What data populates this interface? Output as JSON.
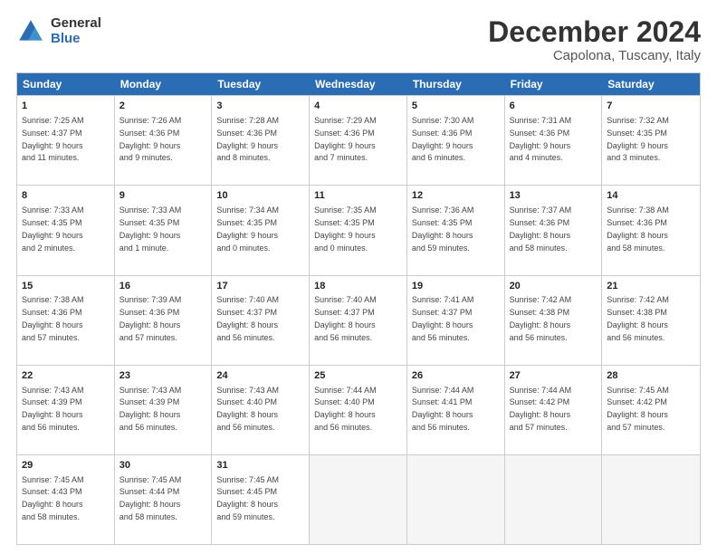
{
  "logo": {
    "general": "General",
    "blue": "Blue"
  },
  "title": "December 2024",
  "location": "Capolona, Tuscany, Italy",
  "header_days": [
    "Sunday",
    "Monday",
    "Tuesday",
    "Wednesday",
    "Thursday",
    "Friday",
    "Saturday"
  ],
  "weeks": [
    [
      {
        "day": "1",
        "info": "Sunrise: 7:25 AM\nSunset: 4:37 PM\nDaylight: 9 hours\nand 11 minutes."
      },
      {
        "day": "2",
        "info": "Sunrise: 7:26 AM\nSunset: 4:36 PM\nDaylight: 9 hours\nand 9 minutes."
      },
      {
        "day": "3",
        "info": "Sunrise: 7:28 AM\nSunset: 4:36 PM\nDaylight: 9 hours\nand 8 minutes."
      },
      {
        "day": "4",
        "info": "Sunrise: 7:29 AM\nSunset: 4:36 PM\nDaylight: 9 hours\nand 7 minutes."
      },
      {
        "day": "5",
        "info": "Sunrise: 7:30 AM\nSunset: 4:36 PM\nDaylight: 9 hours\nand 6 minutes."
      },
      {
        "day": "6",
        "info": "Sunrise: 7:31 AM\nSunset: 4:36 PM\nDaylight: 9 hours\nand 4 minutes."
      },
      {
        "day": "7",
        "info": "Sunrise: 7:32 AM\nSunset: 4:35 PM\nDaylight: 9 hours\nand 3 minutes."
      }
    ],
    [
      {
        "day": "8",
        "info": "Sunrise: 7:33 AM\nSunset: 4:35 PM\nDaylight: 9 hours\nand 2 minutes."
      },
      {
        "day": "9",
        "info": "Sunrise: 7:33 AM\nSunset: 4:35 PM\nDaylight: 9 hours\nand 1 minute."
      },
      {
        "day": "10",
        "info": "Sunrise: 7:34 AM\nSunset: 4:35 PM\nDaylight: 9 hours\nand 0 minutes."
      },
      {
        "day": "11",
        "info": "Sunrise: 7:35 AM\nSunset: 4:35 PM\nDaylight: 9 hours\nand 0 minutes."
      },
      {
        "day": "12",
        "info": "Sunrise: 7:36 AM\nSunset: 4:35 PM\nDaylight: 8 hours\nand 59 minutes."
      },
      {
        "day": "13",
        "info": "Sunrise: 7:37 AM\nSunset: 4:36 PM\nDaylight: 8 hours\nand 58 minutes."
      },
      {
        "day": "14",
        "info": "Sunrise: 7:38 AM\nSunset: 4:36 PM\nDaylight: 8 hours\nand 58 minutes."
      }
    ],
    [
      {
        "day": "15",
        "info": "Sunrise: 7:38 AM\nSunset: 4:36 PM\nDaylight: 8 hours\nand 57 minutes."
      },
      {
        "day": "16",
        "info": "Sunrise: 7:39 AM\nSunset: 4:36 PM\nDaylight: 8 hours\nand 57 minutes."
      },
      {
        "day": "17",
        "info": "Sunrise: 7:40 AM\nSunset: 4:37 PM\nDaylight: 8 hours\nand 56 minutes."
      },
      {
        "day": "18",
        "info": "Sunrise: 7:40 AM\nSunset: 4:37 PM\nDaylight: 8 hours\nand 56 minutes."
      },
      {
        "day": "19",
        "info": "Sunrise: 7:41 AM\nSunset: 4:37 PM\nDaylight: 8 hours\nand 56 minutes."
      },
      {
        "day": "20",
        "info": "Sunrise: 7:42 AM\nSunset: 4:38 PM\nDaylight: 8 hours\nand 56 minutes."
      },
      {
        "day": "21",
        "info": "Sunrise: 7:42 AM\nSunset: 4:38 PM\nDaylight: 8 hours\nand 56 minutes."
      }
    ],
    [
      {
        "day": "22",
        "info": "Sunrise: 7:43 AM\nSunset: 4:39 PM\nDaylight: 8 hours\nand 56 minutes."
      },
      {
        "day": "23",
        "info": "Sunrise: 7:43 AM\nSunset: 4:39 PM\nDaylight: 8 hours\nand 56 minutes."
      },
      {
        "day": "24",
        "info": "Sunrise: 7:43 AM\nSunset: 4:40 PM\nDaylight: 8 hours\nand 56 minutes."
      },
      {
        "day": "25",
        "info": "Sunrise: 7:44 AM\nSunset: 4:40 PM\nDaylight: 8 hours\nand 56 minutes."
      },
      {
        "day": "26",
        "info": "Sunrise: 7:44 AM\nSunset: 4:41 PM\nDaylight: 8 hours\nand 56 minutes."
      },
      {
        "day": "27",
        "info": "Sunrise: 7:44 AM\nSunset: 4:42 PM\nDaylight: 8 hours\nand 57 minutes."
      },
      {
        "day": "28",
        "info": "Sunrise: 7:45 AM\nSunset: 4:42 PM\nDaylight: 8 hours\nand 57 minutes."
      }
    ],
    [
      {
        "day": "29",
        "info": "Sunrise: 7:45 AM\nSunset: 4:43 PM\nDaylight: 8 hours\nand 58 minutes."
      },
      {
        "day": "30",
        "info": "Sunrise: 7:45 AM\nSunset: 4:44 PM\nDaylight: 8 hours\nand 58 minutes."
      },
      {
        "day": "31",
        "info": "Sunrise: 7:45 AM\nSunset: 4:45 PM\nDaylight: 8 hours\nand 59 minutes."
      },
      {
        "day": "",
        "info": ""
      },
      {
        "day": "",
        "info": ""
      },
      {
        "day": "",
        "info": ""
      },
      {
        "day": "",
        "info": ""
      }
    ]
  ]
}
